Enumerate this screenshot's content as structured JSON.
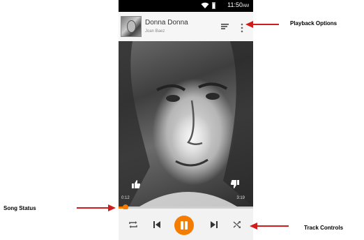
{
  "status_bar": {
    "time": "11:50",
    "ampm": "AM"
  },
  "now_playing": {
    "title": "Donna Donna",
    "artist": "Joan Baez",
    "elapsed": "0:12",
    "total": "3:19",
    "progress_fraction": 0.05
  },
  "icons": {
    "queue": "queue-icon",
    "more": "more-vertical-icon",
    "thumb_up": "thumb-up-icon",
    "thumb_down": "thumb-down-icon",
    "repeat": "repeat-icon",
    "previous": "skip-previous-icon",
    "play_pause": "pause-icon",
    "next": "skip-next-icon",
    "shuffle": "shuffle-icon"
  },
  "colors": {
    "accent": "#f57c00",
    "annotation_arrow": "#d11c1c"
  },
  "annotations": {
    "playback_options": "Playback Options",
    "song_status": "Song Status",
    "track_controls": "Track Controls"
  }
}
